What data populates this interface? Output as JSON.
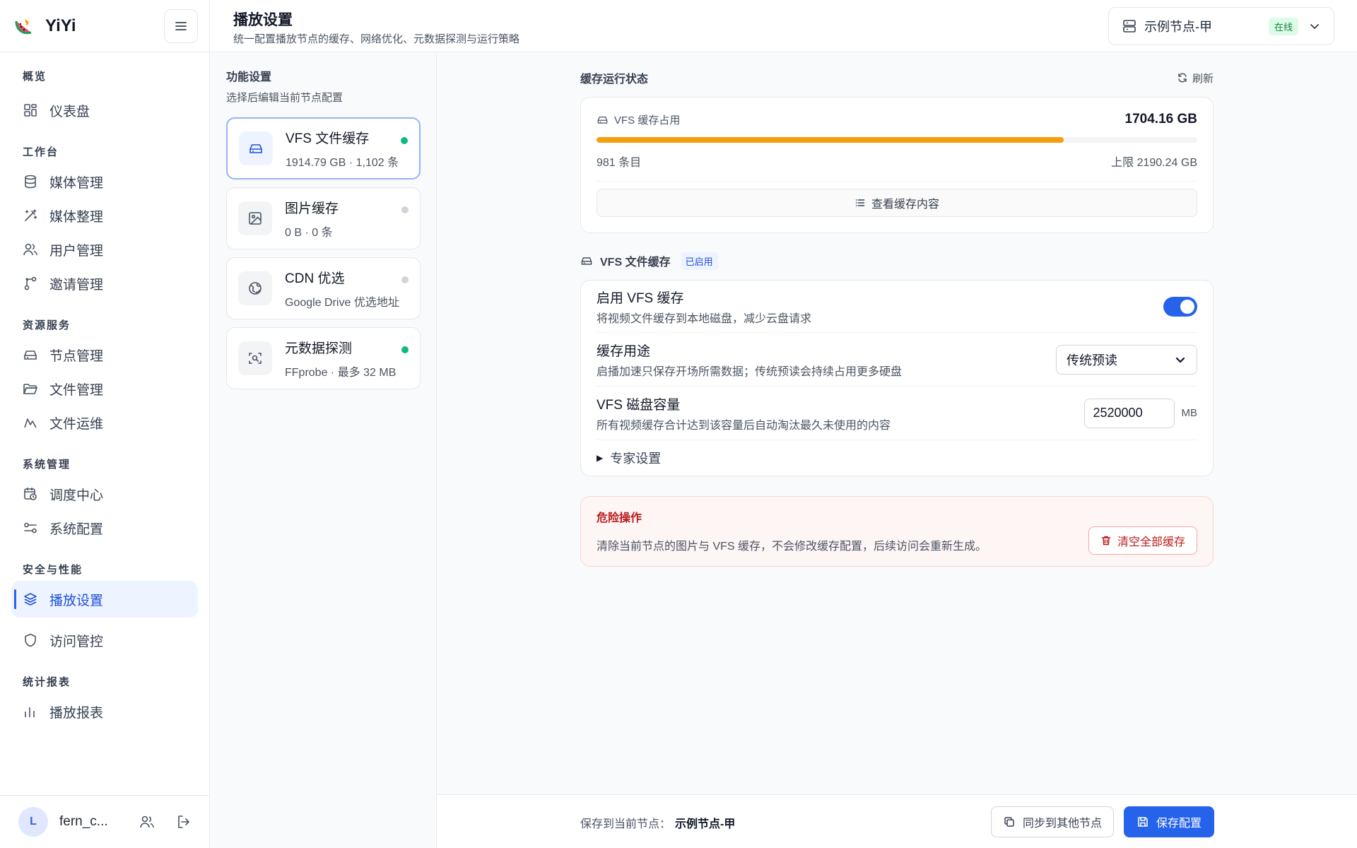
{
  "app": {
    "name": "YiYi"
  },
  "sidebar": {
    "sections": [
      {
        "title": "概览",
        "items": [
          {
            "label": "仪表盘",
            "icon": "dashboard-icon"
          }
        ]
      },
      {
        "title": "工作台",
        "items": [
          {
            "label": "媒体管理",
            "icon": "database-icon"
          },
          {
            "label": "媒体整理",
            "icon": "magic-wand-icon"
          },
          {
            "label": "用户管理",
            "icon": "users-icon"
          },
          {
            "label": "邀请管理",
            "icon": "share-icon"
          }
        ]
      },
      {
        "title": "资源服务",
        "items": [
          {
            "label": "节点管理",
            "icon": "drive-icon"
          },
          {
            "label": "文件管理",
            "icon": "folder-icon"
          },
          {
            "label": "文件运维",
            "icon": "chart-icon"
          }
        ]
      },
      {
        "title": "系统管理",
        "items": [
          {
            "label": "调度中心",
            "icon": "calendar-clock-icon"
          },
          {
            "label": "系统配置",
            "icon": "sliders-icon"
          }
        ]
      },
      {
        "title": "安全与性能",
        "items": [
          {
            "label": "播放设置",
            "icon": "layers-icon",
            "active": true
          },
          {
            "label": "访问管控",
            "icon": "shield-icon"
          }
        ]
      },
      {
        "title": "统计报表",
        "items": [
          {
            "label": "播放报表",
            "icon": "bar-chart-icon"
          }
        ]
      }
    ],
    "user": {
      "initial": "L",
      "name": "fern_c..."
    }
  },
  "header": {
    "title": "播放设置",
    "subtitle": "统一配置播放节点的缓存、网络优化、元数据探测与运行策略",
    "node": {
      "name": "示例节点-甲",
      "status": "在线"
    }
  },
  "features": {
    "title": "功能设置",
    "subtitle": "选择后编辑当前节点配置",
    "items": [
      {
        "name": "VFS 文件缓存",
        "meta": "1914.79 GB · 1,102 条",
        "enabled": true,
        "active": true,
        "icon": "drive-icon"
      },
      {
        "name": "图片缓存",
        "meta": "0 B · 0 条",
        "enabled": false,
        "icon": "image-icon"
      },
      {
        "name": "CDN 优选",
        "meta": "Google Drive 优选地址",
        "enabled": false,
        "icon": "globe-icon"
      },
      {
        "name": "元数据探测",
        "meta": "FFprobe · 最多 32 MB",
        "enabled": true,
        "icon": "scan-icon"
      }
    ]
  },
  "cache_status": {
    "title": "缓存运行状态",
    "refresh_label": "刷新",
    "usage_label": "VFS 缓存占用",
    "usage_value": "1704.16 GB",
    "usage_fraction": 0.778,
    "entries": "981 条目",
    "limit": "上限 2190.24 GB",
    "view_label": "查看缓存内容"
  },
  "vfs": {
    "title": "VFS 文件缓存",
    "badge": "已启用",
    "enable": {
      "label": "启用 VFS 缓存",
      "desc": "将视频文件缓存到本地磁盘，减少云盘请求",
      "on": true
    },
    "purpose": {
      "label": "缓存用途",
      "desc": "启播加速只保存开场所需数据；传统预读会持续占用更多硬盘",
      "value": "传统预读"
    },
    "capacity": {
      "label": "VFS 磁盘容量",
      "desc": "所有视频缓存合计达到该容量后自动淘汰最久未使用的内容",
      "value": "2520000",
      "unit": "MB"
    },
    "expert_label": "专家设置"
  },
  "danger": {
    "title": "危险操作",
    "desc": "清除当前节点的图片与 VFS 缓存，不会修改缓存配置，后续访问会重新生成。",
    "button": "清空全部缓存"
  },
  "footer": {
    "save_to_label": "保存到当前节点：",
    "node_name": "示例节点-甲",
    "sync_label": "同步到其他节点",
    "save_label": "保存配置"
  },
  "colors": {
    "accent": "#2563eb",
    "usage_bar": "#f59e0b",
    "online": "#15803d",
    "danger": "#b91c1c",
    "enabled_dot": "#10b981"
  }
}
